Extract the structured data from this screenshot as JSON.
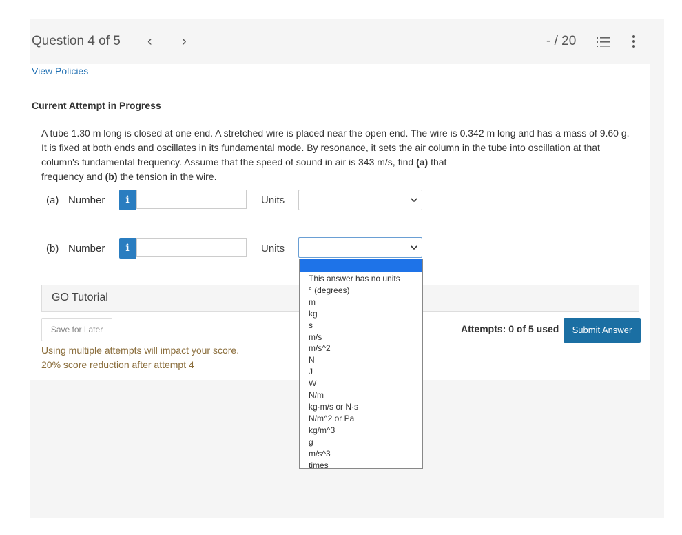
{
  "header": {
    "question_label": "Question 4 of 5",
    "prev_label": "‹",
    "next_label": "›",
    "score": "- / 20",
    "list_icon": "list-icon",
    "more_icon": "vertical-dots-icon"
  },
  "policies_link": "View Policies",
  "attempt_heading": "Current Attempt in Progress",
  "problem": {
    "line1": "A tube 1.30 m long is closed at one end. A stretched wire is placed near the open end. The wire is 0.342 m long and has a mass of 9.60 g.",
    "line2": "It is fixed at both ends and oscillates in its fundamental mode. By resonance, it sets the air column in the tube into oscillation at that",
    "line3a": "column's fundamental frequency. Assume that the speed of sound in air is 343 m/s, find ",
    "line3b": "(a)",
    "line3c": " that",
    "line4a": "frequency and ",
    "line4b": "(b)",
    "line4c": " the tension in the wire."
  },
  "part_a": {
    "letter": "(a)",
    "label": "Number",
    "info": "i",
    "value": "",
    "units_label": "Units",
    "units_value": ""
  },
  "part_b": {
    "letter": "(b)",
    "label": "Number",
    "info": "i",
    "value": "",
    "units_label": "Units",
    "units_value": ""
  },
  "units_options": [
    "",
    "This answer has no units",
    "° (degrees)",
    "m",
    "kg",
    "s",
    "m/s",
    "m/s^2",
    "N",
    "J",
    "W",
    "N/m",
    "kg·m/s or N·s",
    "N/m^2 or Pa",
    "kg/m^3",
    "g",
    "m/s^3",
    "times"
  ],
  "go_tutorial": "GO Tutorial",
  "save_button": "Save for Later",
  "penalty_line1": "Using multiple attempts will impact your score.",
  "penalty_line2": "20% score reduction after attempt 4",
  "attempts": "Attempts: 0 of 5 used",
  "submit_button": "Submit Answer",
  "colors": {
    "link": "#1f6fb2",
    "info_button": "#2a7dc0",
    "submit": "#1b6fa3",
    "penalty_text": "#8a6d3b",
    "dropdown_highlight": "#1e73e8"
  }
}
